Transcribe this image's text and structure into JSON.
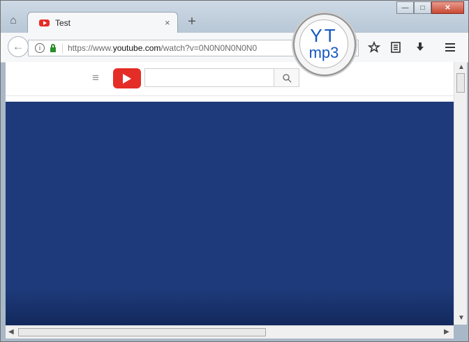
{
  "tab": {
    "title": "Test",
    "close": "×"
  },
  "new_tab": "+",
  "window_controls": {
    "minimize": "—",
    "maximize": "□",
    "close": "✕"
  },
  "address": {
    "scheme": "https://www.",
    "host": "youtube.com",
    "path": "/watch?v=0N0N0N0N0N0"
  },
  "overlay": {
    "line1": "YT",
    "line2": "mp3"
  },
  "icons": {
    "home": "home-icon",
    "back": "back-icon",
    "info": "info-icon",
    "lock": "lock-icon",
    "bookmark": "star-icon",
    "reader": "reader-icon",
    "download": "download-icon",
    "menu": "hamburger-icon",
    "youtube_logo": "youtube-logo-icon",
    "search": "search-icon"
  },
  "colors": {
    "video_background": "#1e3a7a",
    "youtube_red": "#e52d27",
    "overlay_text": "#1557c1"
  }
}
